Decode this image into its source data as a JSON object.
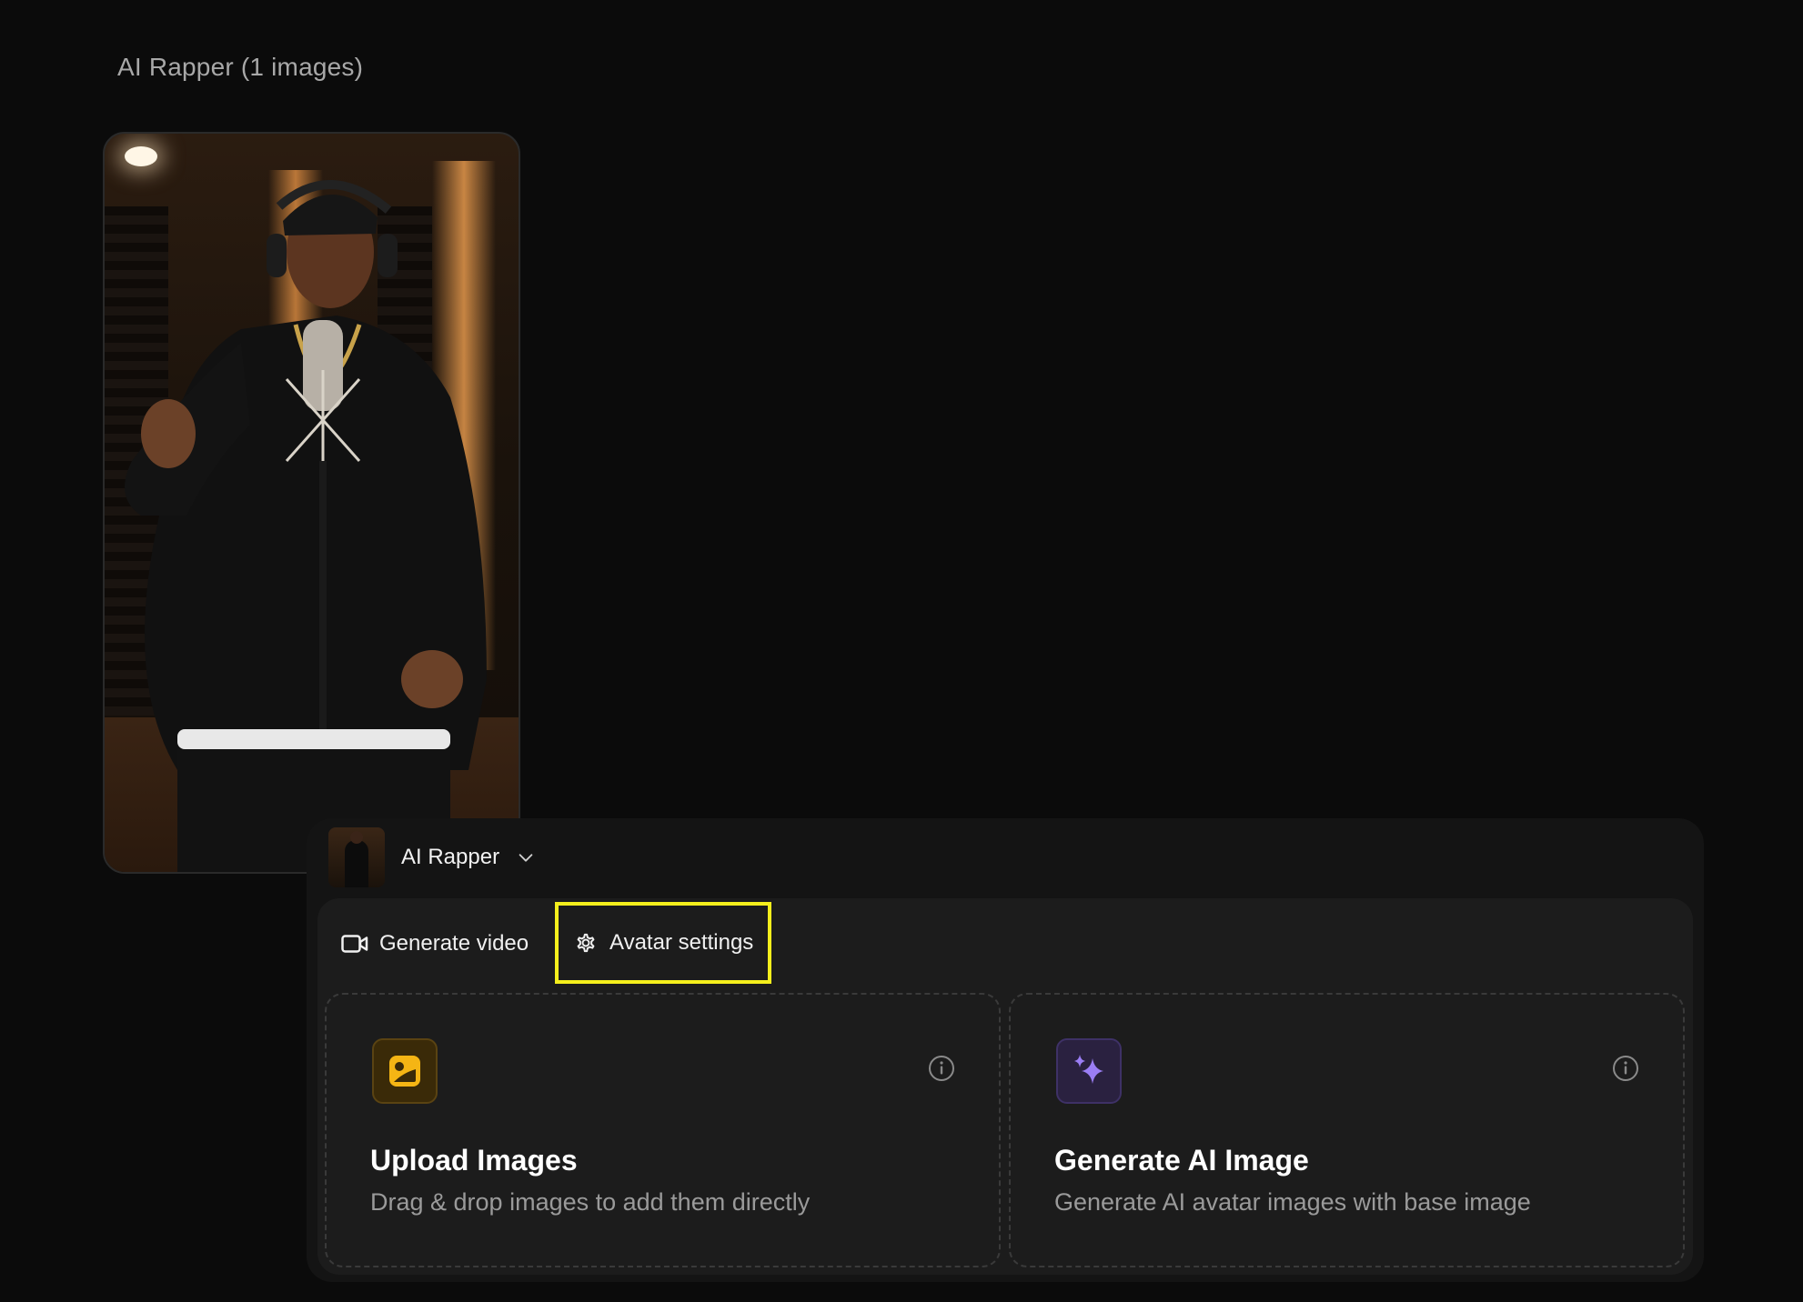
{
  "gallery": {
    "title": "AI Rapper (1 images)"
  },
  "avatar_selector": {
    "name": "AI Rapper"
  },
  "tabs": {
    "generate_video": "Generate video",
    "avatar_settings": "Avatar settings"
  },
  "cards": {
    "upload": {
      "title": "Upload Images",
      "description": "Drag & drop images to add them directly",
      "icon": "image-upload-icon"
    },
    "generate": {
      "title": "Generate AI Image",
      "description": "Generate AI avatar images with base image",
      "icon": "sparkles-icon"
    }
  },
  "colors": {
    "background": "#0b0b0b",
    "panel": "#141414",
    "panel_inner": "#1c1c1c",
    "highlight": "#f4ee1c",
    "upload_accent": "#f5b514",
    "generate_accent": "#9b7ef5",
    "muted_text": "#9a9a9a"
  }
}
